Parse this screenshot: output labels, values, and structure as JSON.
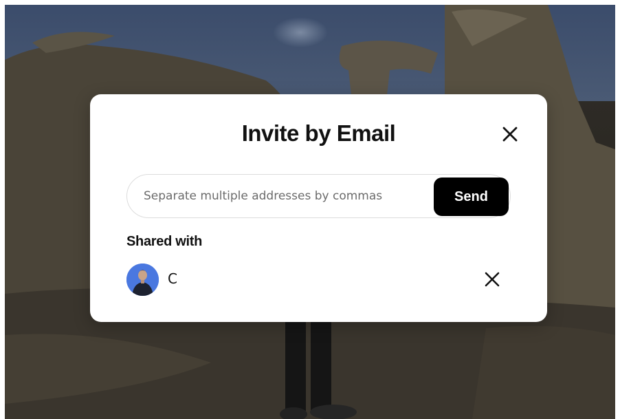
{
  "modal": {
    "title": "Invite by Email",
    "close_icon": "close-icon",
    "email_input": {
      "value": "",
      "placeholder": "Separate multiple addresses by commas"
    },
    "send_label": "Send",
    "shared_heading": "Shared with",
    "shared_users": [
      {
        "name": "C",
        "avatar": "avatar-user-icon",
        "remove_icon": "close-icon"
      }
    ]
  },
  "colors": {
    "modal_bg": "#ffffff",
    "send_button_bg": "#000000",
    "avatar_bg": "#4a78e0",
    "text": "#111111",
    "placeholder": "#6b6b6b"
  }
}
